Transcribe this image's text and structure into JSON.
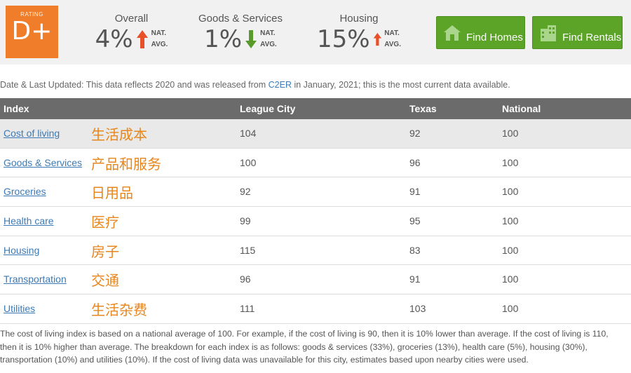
{
  "rating": {
    "label": "RATING",
    "grade": "D+"
  },
  "metrics": [
    {
      "title": "Overall",
      "value": "4%",
      "direction": "up",
      "nat": "NAT.",
      "avg": "AVG."
    },
    {
      "title": "Goods & Services",
      "value": "1%",
      "direction": "down",
      "nat": "NAT.",
      "avg": "AVG."
    },
    {
      "title": "Housing",
      "value": "15%",
      "direction": "up",
      "nat": "NAT.",
      "avg": "AVG."
    }
  ],
  "buttons": {
    "homes": "Find Homes",
    "rentals": "Find Rentals"
  },
  "updated": {
    "prefix": "Date & Last Updated: This data reflects 2020 and was released from ",
    "link": "C2ER",
    "suffix": " in January, 2021; this is the most current data available."
  },
  "table": {
    "headers": {
      "index": "Index",
      "city": "League City",
      "state": "Texas",
      "national": "National"
    },
    "rows": [
      {
        "index": "Cost of living",
        "cn": "生活成本",
        "city": "104",
        "state": "92",
        "national": "100"
      },
      {
        "index": "Goods & Services",
        "cn": "产品和服务",
        "city": "100",
        "state": "96",
        "national": "100"
      },
      {
        "index": "Groceries",
        "cn": "日用品",
        "city": "92",
        "state": "91",
        "national": "100"
      },
      {
        "index": "Health care",
        "cn": "医疗",
        "city": "99",
        "state": "95",
        "national": "100"
      },
      {
        "index": "Housing",
        "cn": "房子",
        "city": "115",
        "state": "83",
        "national": "100"
      },
      {
        "index": "Transportation",
        "cn": "交通",
        "city": "96",
        "state": "91",
        "national": "100"
      },
      {
        "index": "Utilities",
        "cn": "生活杂费",
        "city": "111",
        "state": "103",
        "national": "100"
      }
    ]
  },
  "footnote": {
    "line1": "The cost of living index is based on a national average of 100. For example, if the cost of living is 90, then it is 10% lower than average. If the cost of living is 110,",
    "line2": "then it is 10% higher than average. The breakdown for each index is as follows: goods & services (33%), groceries (13%), health care (5%), housing (30%),",
    "line3": "transportation (10%) and utilities (10%). If the cost of living data was unavailable for this city, estimates based upon nearby cities were used."
  },
  "colors": {
    "grade_bg": "#ef7d2a",
    "up_arrow": "#e8502a",
    "down_arrow": "#5a9a2a",
    "button": "#5ba427",
    "header": "#6b6b6b",
    "link": "#3b7ab6",
    "annotation": "#e8861c"
  }
}
